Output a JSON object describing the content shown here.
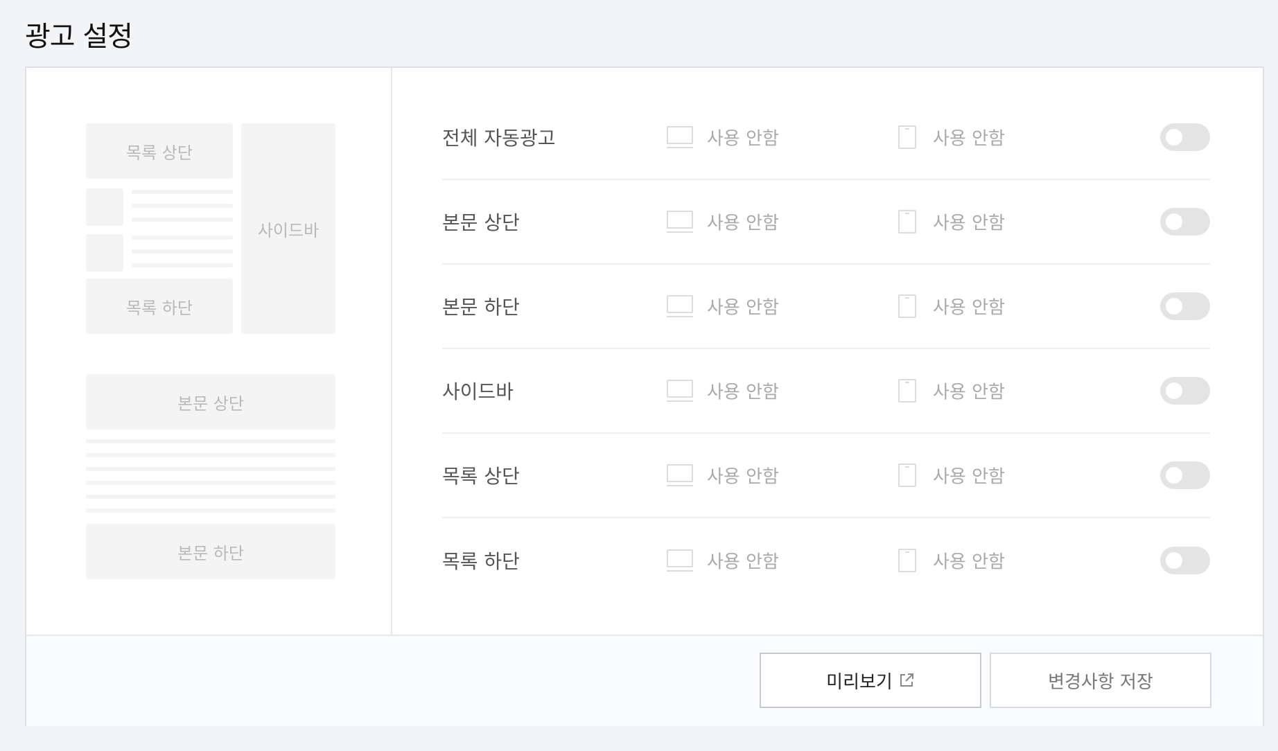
{
  "title": "광고 설정",
  "preview": {
    "list_top": "목록 상단",
    "list_bottom": "목록 하단",
    "sidebar": "사이드바",
    "body_top": "본문 상단",
    "body_bottom": "본문 하단"
  },
  "rows": [
    {
      "label": "전체 자동광고",
      "pc_status": "사용 안함",
      "mobile_status": "사용 안함",
      "enabled": false
    },
    {
      "label": "본문 상단",
      "pc_status": "사용 안함",
      "mobile_status": "사용 안함",
      "enabled": false
    },
    {
      "label": "본문 하단",
      "pc_status": "사용 안함",
      "mobile_status": "사용 안함",
      "enabled": false
    },
    {
      "label": "사이드바",
      "pc_status": "사용 안함",
      "mobile_status": "사용 안함",
      "enabled": false
    },
    {
      "label": "목록 상단",
      "pc_status": "사용 안함",
      "mobile_status": "사용 안함",
      "enabled": false
    },
    {
      "label": "목록 하단",
      "pc_status": "사용 안함",
      "mobile_status": "사용 안함",
      "enabled": false
    }
  ],
  "footer": {
    "preview_label": "미리보기",
    "save_label": "변경사항 저장"
  },
  "icons": {
    "pc": "monitor-icon",
    "mobile": "mobile-icon",
    "external": "external-link-icon"
  },
  "colors": {
    "toggle_off": "#e4e4e4",
    "placeholder": "#f4f4f4",
    "background": "#f3f4f6"
  }
}
